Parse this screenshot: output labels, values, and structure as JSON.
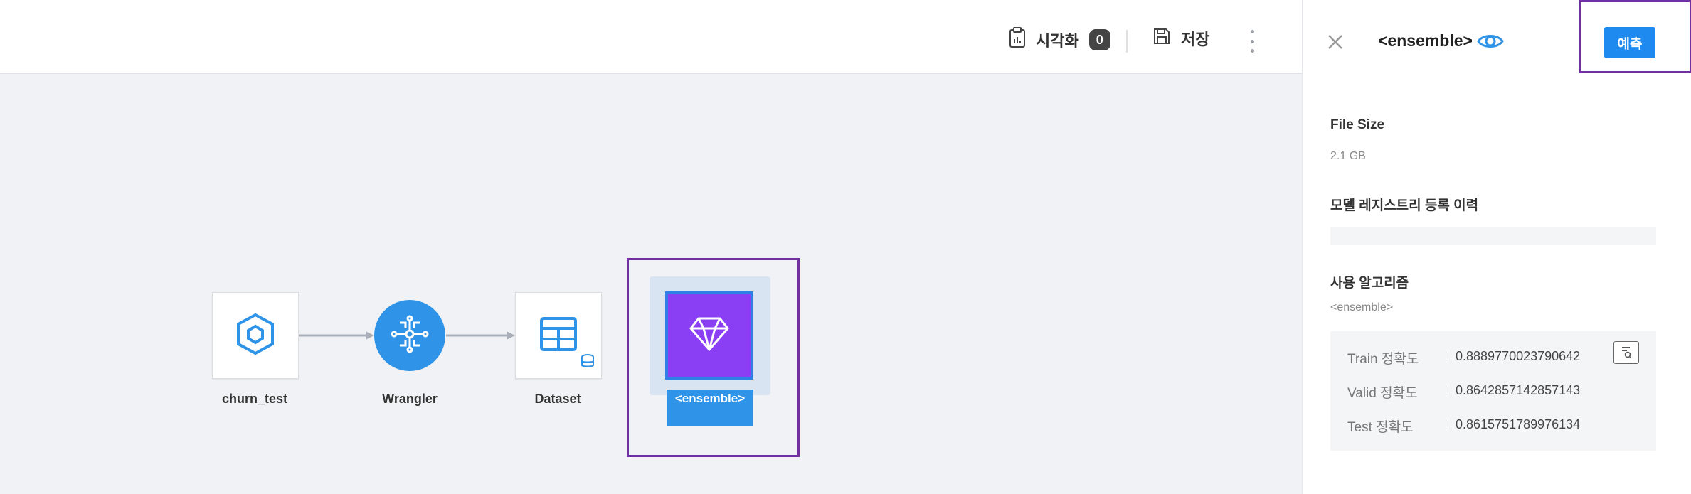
{
  "toolbar": {
    "visualize_label": "시각화",
    "visualize_count": "0",
    "save_label": "저장"
  },
  "flow": {
    "nodes": [
      {
        "label": "churn_test",
        "icon": "hexagon-icon"
      },
      {
        "label": "Wrangler",
        "icon": "wrangler-network-icon"
      },
      {
        "label": "Dataset",
        "icon": "table-database-icon"
      },
      {
        "label": "<ensemble>",
        "icon": "diamond-icon"
      }
    ]
  },
  "panel": {
    "title": "<ensemble>",
    "predict_label": "예측",
    "file_size_label": "File Size",
    "file_size_value": "2.1 GB",
    "registry_label": "모델 레지스트리 등록 이력",
    "algorithm_label": "사용 알고리즘",
    "algorithm_value": "<ensemble>",
    "metrics": [
      {
        "label": "Train 정확도",
        "value": "0.8889770023790642"
      },
      {
        "label": "Valid 정확도",
        "value": "0.8642857142857143"
      },
      {
        "label": "Test 정확도",
        "value": "0.8615751789976134"
      }
    ]
  },
  "colors": {
    "accent_blue": "#2f94e8",
    "button_blue": "#1e8af0",
    "ensemble_purple": "#8a3ff5",
    "highlight_purple": "#7030a0"
  }
}
